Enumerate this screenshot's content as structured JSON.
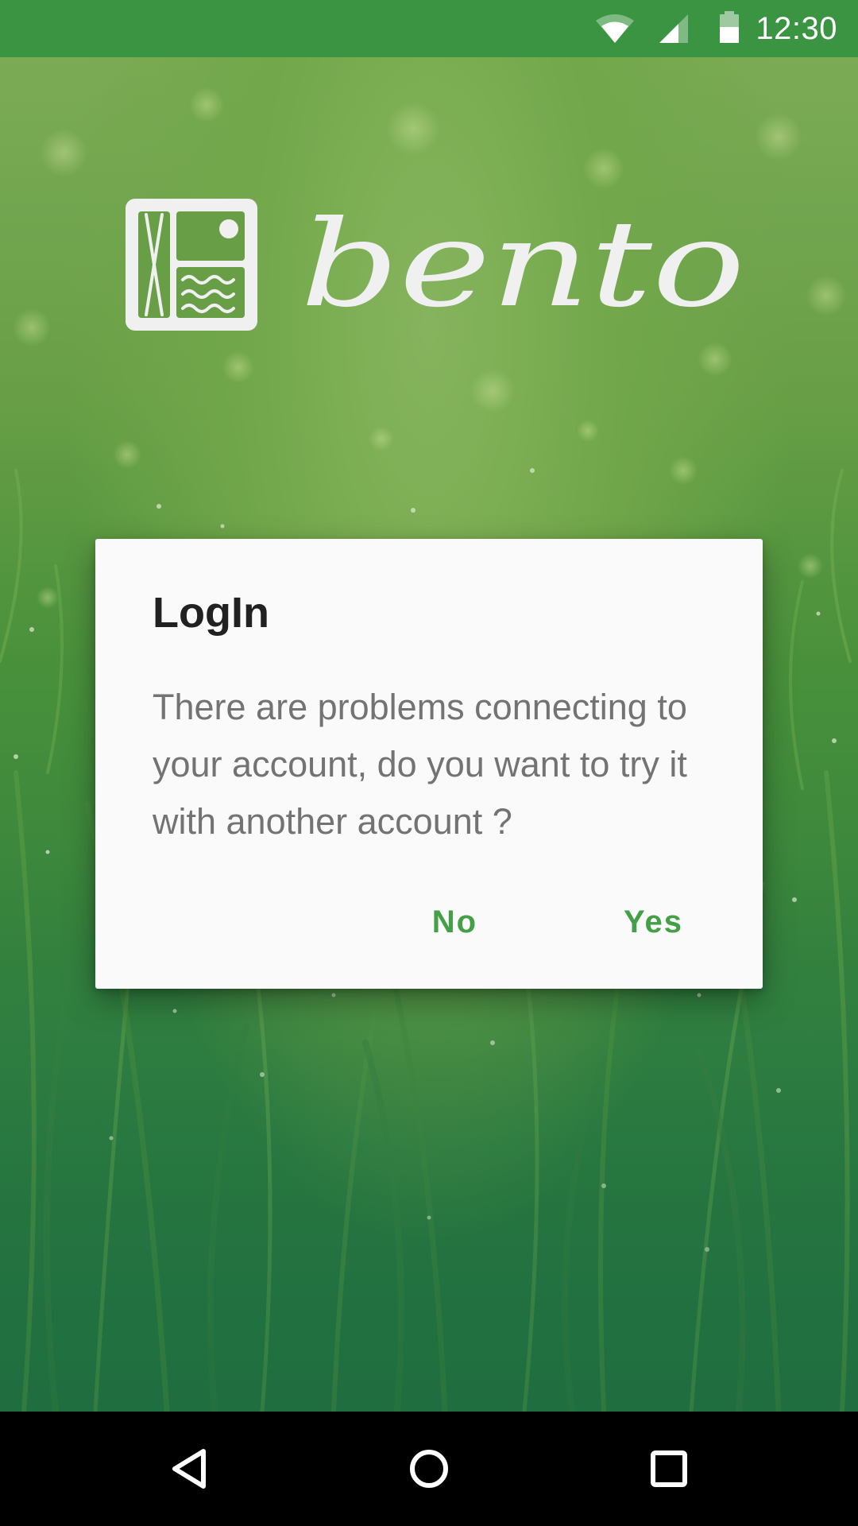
{
  "status_bar": {
    "time": "12:30",
    "icons": [
      "wifi-icon",
      "cell-signal-icon",
      "battery-icon"
    ],
    "background": "#3b9442"
  },
  "app": {
    "name": "bento",
    "logo_color": "#ffffff"
  },
  "dialog": {
    "title": "LogIn",
    "message": "There are problems connecting to your account, do you want to try it with another account ?",
    "buttons": {
      "negative": "No",
      "positive": "Yes"
    },
    "accent_color": "#43a047"
  },
  "nav_bar": {
    "buttons": [
      "back-icon",
      "home-icon",
      "recents-icon"
    ]
  }
}
